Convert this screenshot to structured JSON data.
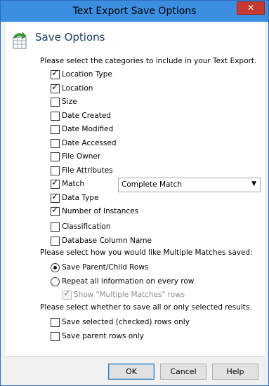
{
  "window": {
    "title": "Text Export Save Options",
    "close_label": "✕"
  },
  "header": {
    "title": "Save Options",
    "icon": "export-spreadsheet-icon"
  },
  "sections": {
    "categories_prompt": "Please select the categories to include in your Text Export.",
    "multiple_prompt": "Please select how you would like Multiple Matches saved:",
    "rows_prompt": "Please select whether to save all or only selected results."
  },
  "categories": [
    {
      "label": "Location Type",
      "checked": true
    },
    {
      "label": "Location",
      "checked": true
    },
    {
      "label": "Size",
      "checked": false
    },
    {
      "label": "Date Created",
      "checked": false
    },
    {
      "label": "Date Modified",
      "checked": false
    },
    {
      "label": "Date Accessed",
      "checked": false
    },
    {
      "label": "File Owner",
      "checked": false
    },
    {
      "label": "File Attributes",
      "checked": false
    },
    {
      "label": "Match",
      "checked": true
    },
    {
      "label": "Data Type",
      "checked": true
    },
    {
      "label": "Number of Instances",
      "checked": true
    },
    {
      "label": "Classification",
      "checked": false
    },
    {
      "label": "Database Column Name",
      "checked": false
    }
  ],
  "match_select": {
    "value": "Complete Match"
  },
  "multiple_matches": {
    "option1": "Save Parent/Child Rows",
    "option2": "Repeat all information on every row",
    "show_label": "Show \"Multiple Matches\" rows",
    "selected": "option1",
    "show_checked": true
  },
  "row_options": [
    {
      "label": "Save selected (checked) rows only",
      "checked": false
    },
    {
      "label": "Save parent rows only",
      "checked": false
    }
  ],
  "buttons": {
    "ok": "OK",
    "cancel": "Cancel",
    "help": "Help"
  }
}
